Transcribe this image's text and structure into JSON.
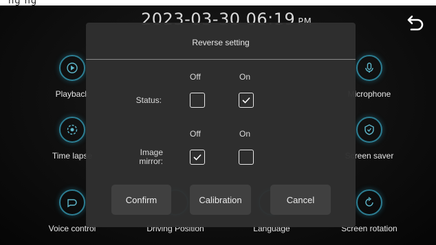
{
  "status_bar": {
    "partial_title": "ng  ng",
    "datetime": "2023-03-30 06:19",
    "ampm": "PM"
  },
  "tiles": [
    {
      "label": "Playback",
      "icon": "play-icon"
    },
    {
      "label": "Time lapse",
      "icon": "timelapse-icon"
    },
    {
      "label": "Voice control",
      "icon": "voice-control-icon"
    },
    {
      "label": "Driving Position",
      "icon": "driving-position-icon"
    },
    {
      "label": "Language",
      "icon": "language-icon"
    },
    {
      "label": "Microphone",
      "icon": "microphone-icon"
    },
    {
      "label": "Screen saver",
      "icon": "screen-saver-icon"
    },
    {
      "label": "Screen rotation",
      "icon": "screen-rotation-icon"
    }
  ],
  "dialog": {
    "title": "Reverse setting",
    "status": {
      "label": "Status:",
      "off_label": "Off",
      "on_label": "On",
      "off_checked": false,
      "on_checked": true
    },
    "image_mirror": {
      "label_line1": "Image",
      "label_line2": "mirror:",
      "off_label": "Off",
      "on_label": "On",
      "off_checked": true,
      "on_checked": false
    },
    "buttons": {
      "confirm": "Confirm",
      "calibration": "Calibration",
      "cancel": "Cancel"
    }
  },
  "colors": {
    "accent": "#2d7e93",
    "dialog_bg": "#303030",
    "button_bg": "#404040",
    "text": "#e8e8e8"
  }
}
